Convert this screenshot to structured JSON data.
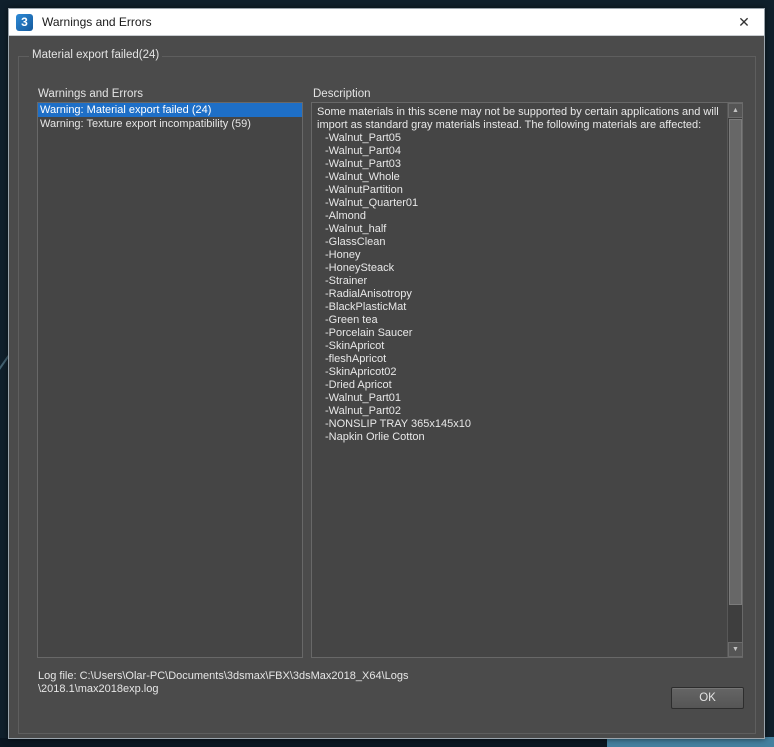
{
  "window": {
    "title": "Warnings and Errors",
    "app_icon_glyph": "3"
  },
  "icons": {
    "close": "✕",
    "scroll_up": "▲",
    "scroll_down": "▼"
  },
  "group": {
    "label": "Material export failed(24)"
  },
  "warnings_panel": {
    "label": "Warnings and Errors",
    "items": [
      {
        "label": "Warning: Material export failed (24)",
        "selected": true
      },
      {
        "label": "Warning: Texture export incompatibility (59)",
        "selected": false
      }
    ]
  },
  "description_panel": {
    "label": "Description",
    "intro": "Some materials in this scene may not be supported by certain applications and will import as standard gray materials instead. The following materials are affected:",
    "materials": [
      "-Walnut_Part05",
      "-Walnut_Part04",
      "-Walnut_Part03",
      "-Walnut_Whole",
      "-WalnutPartition",
      "-Walnut_Quarter01",
      "-Almond",
      "-Walnut_half",
      "-GlassClean",
      "-Honey",
      "-HoneySteack",
      "-Strainer",
      "-RadialAnisotropy",
      "-BlackPlasticMat",
      "-Green tea",
      "-Porcelain Saucer",
      "-SkinApricot",
      "-fleshApricot",
      "-SkinApricot02",
      "-Dried Apricot",
      "-Walnut_Part01",
      "-Walnut_Part02",
      "-NONSLIP TRAY 365x145x10",
      "-Napkin Orlie Cotton"
    ]
  },
  "footer": {
    "log_line1": "Log file: C:\\Users\\Olar-PC\\Documents\\3dsmax\\FBX\\3dsMax2018_X64\\Logs",
    "log_line2": "\\2018.1\\max2018exp.log",
    "ok_label": "OK"
  },
  "colors": {
    "dialog_bg": "#4b4b4b",
    "titlebar_bg": "#ffffff",
    "selection_blue": "#1e6fc7",
    "box_bg": "#454545",
    "text_light": "#e8e8e8",
    "backdrop": "#10202c",
    "backdrop_corner": "#44809f"
  }
}
